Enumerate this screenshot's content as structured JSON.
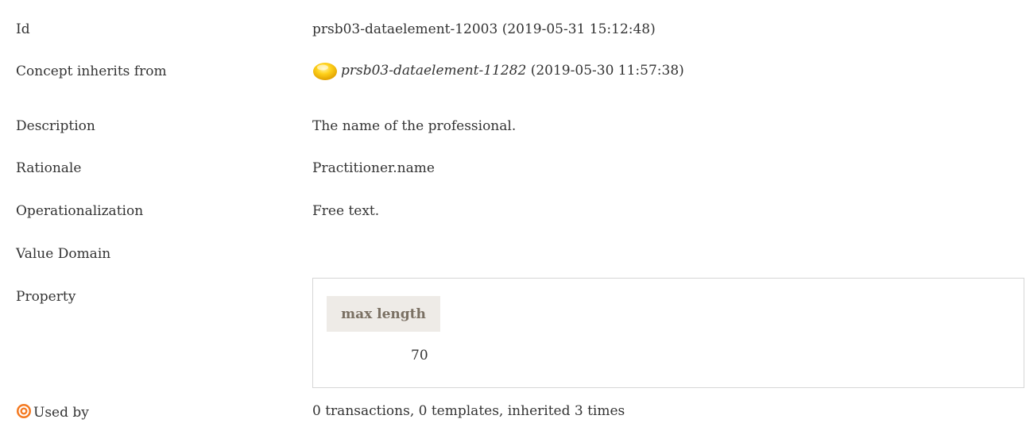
{
  "rows": {
    "id": {
      "label": "Id",
      "value": "prsb03-dataelement-12003 (2019-05-31 15:12:48)"
    },
    "inherits": {
      "label": "Concept inherits from",
      "link": "prsb03-dataelement-11282",
      "suffix": " (2019-05-30 11:57:38)"
    },
    "description": {
      "label": "Description",
      "value": "The name of the professional."
    },
    "rationale": {
      "label": "Rationale",
      "value": "Practitioner.name"
    },
    "operationalization": {
      "label": "Operationalization",
      "value": "Free text."
    },
    "value_domain": {
      "label": "Value Domain"
    },
    "property": {
      "label": "Property",
      "header": "max length",
      "value": "70"
    },
    "used_by": {
      "label": "Used by",
      "value": "0 transactions, 0 templates, inherited 3 times",
      "icon": "target-icon"
    }
  },
  "colors": {
    "text": "#333333",
    "property_header_bg": "#eeebe7",
    "property_header_text": "#7a7063",
    "status_ball": "#f5c400",
    "target_icon": "#f47920"
  }
}
